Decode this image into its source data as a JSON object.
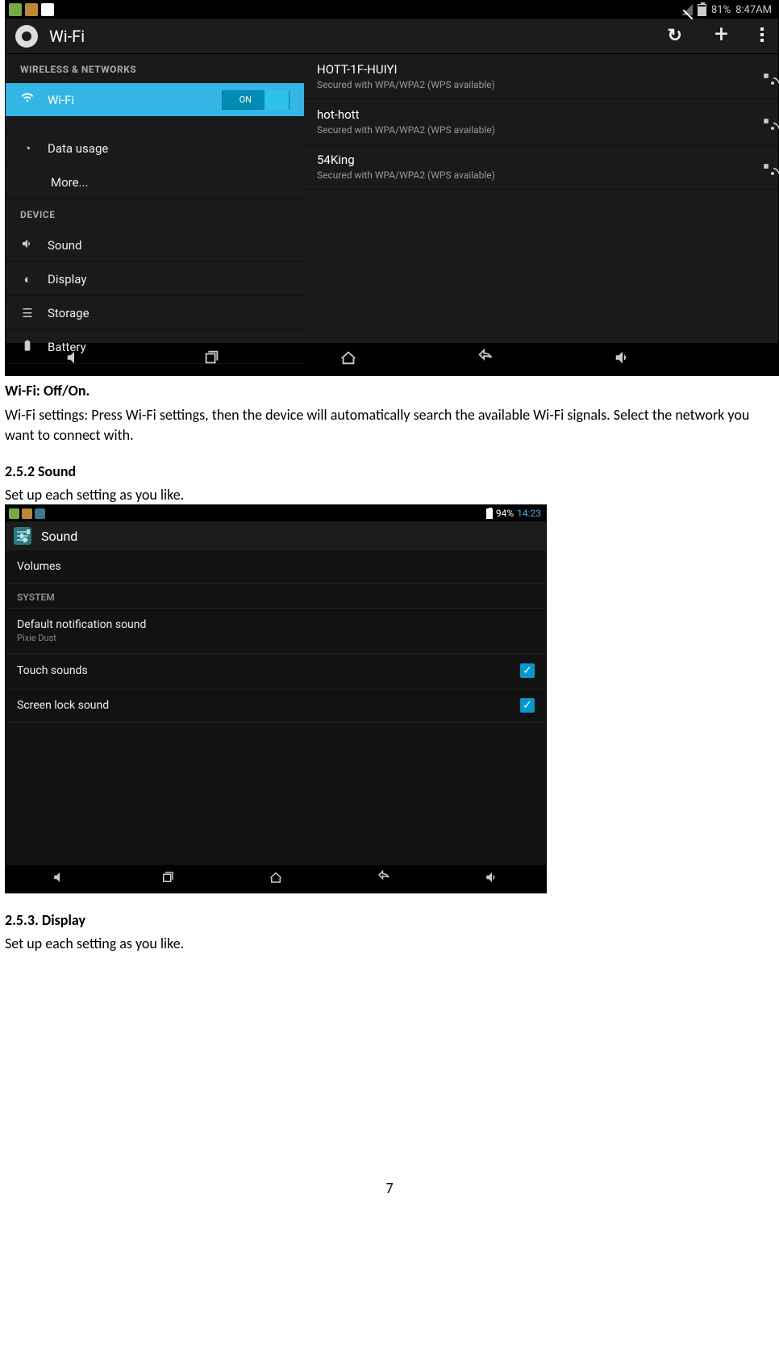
{
  "screenshot1": {
    "statusbar": {
      "battery_text": "81%",
      "clock": "8:47AM"
    },
    "appbar": {
      "title": "Wi-Fi"
    },
    "sidebar": {
      "header1": "WIRELESS & NETWORKS",
      "wifi": "Wi-Fi",
      "wifi_toggle": "ON",
      "data_usage": "Data usage",
      "more": "More...",
      "header2": "DEVICE",
      "sound": "Sound",
      "display": "Display",
      "storage": "Storage",
      "battery": "Battery"
    },
    "networks": [
      {
        "name": "HOTT-1F-HUIYI",
        "sub": "Secured with WPA/WPA2 (WPS available)"
      },
      {
        "name": "hot-hott",
        "sub": "Secured with WPA/WPA2 (WPS available)"
      },
      {
        "name": "54King",
        "sub": "Secured with WPA/WPA2 (WPS available)"
      }
    ]
  },
  "doc": {
    "wifi_head": "Wi-Fi: Off/On.",
    "wifi_body": "Wi-Fi settings: Press Wi-Fi settings, then the device will automatically search the available Wi-Fi signals. Select the network you want to connect with.",
    "sound_head": "2.5.2    Sound",
    "sound_body": "Set up each setting as you like.",
    "display_head": "2.5.3. Display",
    "display_body": "Set up each setting as you like.",
    "page_num": "7"
  },
  "screenshot2": {
    "statusbar": {
      "battery_text": "94%",
      "clock": "14:23"
    },
    "appbar": {
      "title": "Sound"
    },
    "rows": {
      "volumes": "Volumes",
      "system_header": "SYSTEM",
      "default_notif": "Default notification sound",
      "default_notif_sub": "Pixie Dust",
      "touch_sounds": "Touch sounds",
      "screen_lock": "Screen lock sound"
    }
  }
}
